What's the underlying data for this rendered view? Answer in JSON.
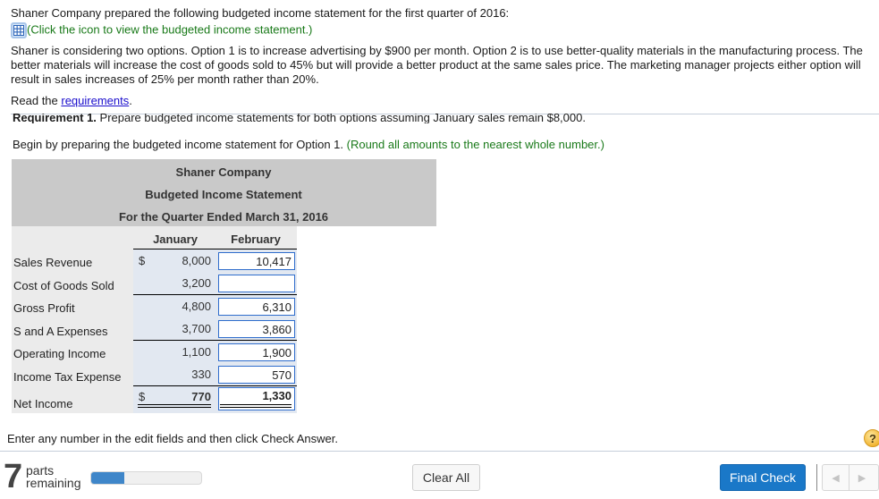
{
  "intro": {
    "line1": "Shaner Company prepared the following budgeted income statement for the first quarter of 2016:",
    "icon_hint": "(Click the icon to view the budgeted income statement.)",
    "para_line1": "Shaner is considering two options. Option 1 is to increase advertising by $900 per month. Option 2 is to use better-quality materials in the manufacturing process. The",
    "para_line2": "better materials will increase the cost of goods sold to 45% but will provide a better product at the same sales price. The marketing manager projects either option will",
    "para_line3": "result in sales increases of 25% per month rather than 20%.",
    "read_prefix": "Read the ",
    "read_link": "requirements",
    "read_suffix": "."
  },
  "requirement": {
    "label": "Requirement 1.",
    "text": " Prepare budgeted income statements for both options assuming January sales remain $8,000.",
    "instruction": "Begin by preparing the budgeted income statement for Option 1. ",
    "instruction_note": "(Round all amounts to the nearest whole number.)"
  },
  "statement": {
    "company": "Shaner Company",
    "title": "Budgeted Income Statement",
    "period": "For the Quarter Ended March 31, 2016",
    "columns": [
      "January",
      "February"
    ],
    "currency_symbol": "$",
    "rows": [
      {
        "label": "Sales Revenue",
        "january": "8,000",
        "february": "10,417"
      },
      {
        "label": "Cost of Goods Sold",
        "january": "3,200",
        "february": ""
      },
      {
        "label": "Gross Profit",
        "january": "4,800",
        "february": "6,310"
      },
      {
        "label": "S and A Expenses",
        "january": "3,700",
        "february": "3,860"
      },
      {
        "label": "Operating Income",
        "january": "1,100",
        "february": "1,900"
      },
      {
        "label": "Income Tax Expense",
        "january": "330",
        "february": "570"
      },
      {
        "label": "Net Income",
        "january": "770",
        "february": "1,330"
      }
    ]
  },
  "footer": {
    "hint": "Enter any number in the edit fields and then click Check Answer.",
    "parts_count": "7",
    "parts_label_1": "parts",
    "parts_label_2": "remaining",
    "progress_fraction": 0.3,
    "clear_all": "Clear All",
    "final_check": "Final Check",
    "help_symbol": "?",
    "prev_symbol": "◀",
    "next_symbol": "▶"
  }
}
